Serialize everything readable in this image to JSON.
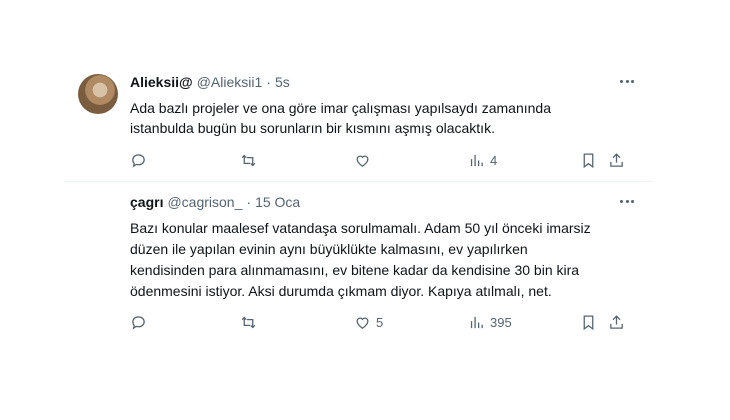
{
  "tweets": [
    {
      "name": "Alieksii@",
      "handle": "@Alieksii1",
      "separator": "·",
      "time": "5s",
      "lines": [
        "Ada bazlı projeler ve ona göre imar çalışması yapılsaydı zamanında",
        "istanbulda bugün bu sorunların bir kısmını aşmış olacaktık."
      ],
      "views": "4",
      "likes": "",
      "retweets": "",
      "replies": ""
    },
    {
      "name": "çagrı",
      "handle": "@cagrison_",
      "separator": "·",
      "time": "15 Oca",
      "lines": [
        "Bazı konular maalesef vatandaşa sorulmamalı. Adam 50 yıl önceki imarsiz",
        "düzen ile yapılan evinin aynı büyüklükte kalmasını, ev yapılırken",
        "kendisinden para alınmamasını, ev bitene kadar da kendisine 30 bin kira",
        "ödenmesini istiyor. Aksi durumda çıkmam diyor. Kapıya atılmalı, net."
      ],
      "views": "395",
      "likes": "5",
      "retweets": "",
      "replies": ""
    }
  ],
  "icons": {
    "reply": "reply-icon",
    "retweet": "retweet-icon",
    "like": "heart-icon",
    "views": "views-icon",
    "bookmark": "bookmark-icon",
    "share": "share-icon",
    "more": "more-icon"
  },
  "colors": {
    "text": "#0f1419",
    "secondary": "#536471",
    "divider": "#eff3f4",
    "background": "#ffffff"
  }
}
